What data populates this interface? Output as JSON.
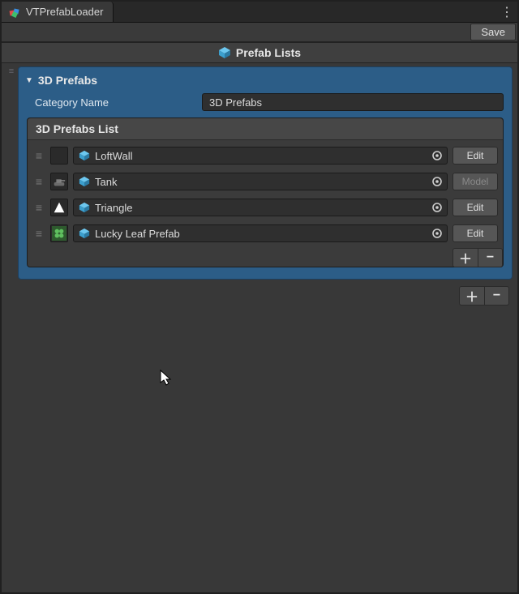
{
  "window": {
    "tab_title": "VTPrefabLoader"
  },
  "toolbar": {
    "save_label": "Save"
  },
  "section": {
    "title": "Prefab Lists"
  },
  "category": {
    "foldout_title": "3D Prefabs",
    "name_label": "Category Name",
    "name_value": "3D Prefabs",
    "list_title": "3D Prefabs List",
    "items": [
      {
        "name": "LoftWall",
        "thumb": "none",
        "button": "Edit",
        "button_enabled": true
      },
      {
        "name": "Tank",
        "thumb": "tank",
        "button": "Model",
        "button_enabled": false
      },
      {
        "name": "Triangle",
        "thumb": "triangle",
        "button": "Edit",
        "button_enabled": true
      },
      {
        "name": "Lucky Leaf Prefab",
        "thumb": "leaf",
        "button": "Edit",
        "button_enabled": true
      }
    ]
  },
  "icons": {
    "plus": "＋",
    "minus": "−",
    "kebab": "⋮",
    "drag": "≡"
  },
  "colors": {
    "accent": "#2c5d87",
    "bg": "#383838",
    "field": "#2f2f2f",
    "button": "#565656",
    "prefab_cube": "#46b1e1"
  }
}
